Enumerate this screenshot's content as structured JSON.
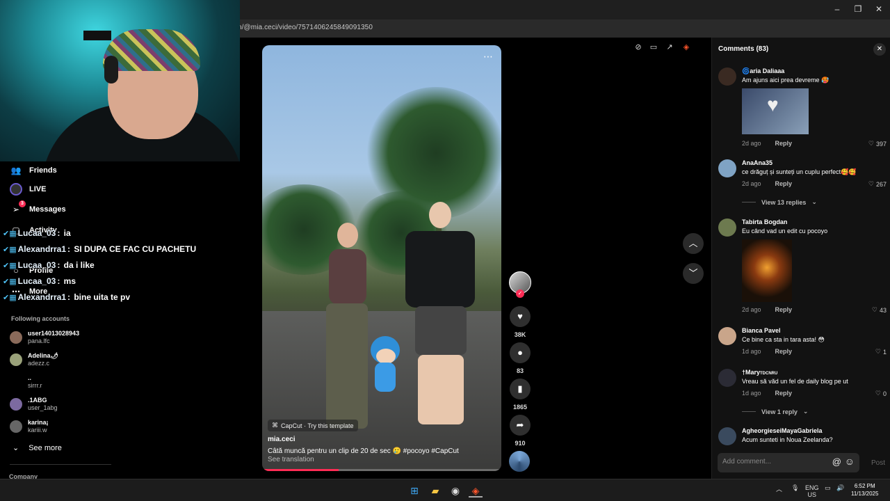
{
  "browser": {
    "url": "n/@mia.ceci/video/7571406245849091350",
    "window_controls": [
      "–",
      "❐",
      "✕"
    ]
  },
  "sidebar": {
    "nav": [
      {
        "label": "Friends",
        "icon": "friends-icon"
      },
      {
        "label": "LIVE",
        "icon": "live-icon"
      },
      {
        "label": "Messages",
        "icon": "messages-icon",
        "badge": "3"
      },
      {
        "label": "Activity",
        "icon": "activity-icon"
      },
      {
        "label": "Profile",
        "icon": "profile-icon"
      },
      {
        "label": "More",
        "icon": "more-icon"
      }
    ],
    "following_title": "Following accounts",
    "accounts": [
      {
        "name": "user14013028943",
        "handle": "pana.lfc"
      },
      {
        "name": "Adelina🌶",
        "handle": "adezz.c"
      },
      {
        "name": "..",
        "handle": "sirrr.r"
      },
      {
        "name": ".1ABG",
        "handle": "user_1abg"
      },
      {
        "name": "karina¡",
        "handle": "kariii.w"
      }
    ],
    "see_more": "See more",
    "company": "Company"
  },
  "chat": [
    {
      "user": "Lucaa_03",
      "message": "ia"
    },
    {
      "user": "Alexandrra1",
      "message": "SI DUPA CE FAC CU PACHETU"
    },
    {
      "user": "Lucaa_03",
      "message": "da i like"
    },
    {
      "user": "Lucaa_03",
      "message": "ms"
    },
    {
      "user": "Alexandrra1",
      "message": "bine uita te pv"
    }
  ],
  "video": {
    "capcut": "CapCut · Try this template",
    "author": "mia.ceci",
    "caption": "Câtă muncă pentru un clip de 20 de sec 🥲 #pocoyo #CapCut",
    "see_translation": "See translation",
    "progress": 0.32
  },
  "actions": {
    "likes": "38K",
    "comments": "83",
    "saves": "1865",
    "shares": "910"
  },
  "comments_panel": {
    "title": "Comments (83)",
    "items": [
      {
        "name": "🌀aria Daliaaa",
        "text": "Am ajuns aici prea devreme 🥵",
        "time": "2d ago",
        "reply": "Reply",
        "likes": "397"
      },
      {
        "name": "AnaAna35",
        "text": "ce drăguț și sunteți un cuplu perfect🥰🥰",
        "time": "2d ago",
        "reply": "Reply",
        "likes": "267",
        "replies": "View 13 replies"
      },
      {
        "name": "Tabirta Bogdan",
        "text": "Eu când vad un edit cu pocoyo",
        "time": "2d ago",
        "reply": "Reply",
        "likes": "43"
      },
      {
        "name": "Bianca Pavel",
        "text": "Ce bine ca sta in tara asta! 😳",
        "time": "1d ago",
        "reply": "Reply",
        "likes": "1"
      },
      {
        "name": "†Mary",
        "name_suffix": "TDCNRU",
        "text": "Vreau să văd un fel de daily blog pe ut",
        "time": "1d ago",
        "reply": "Reply",
        "likes": "0",
        "replies": "View 1 reply"
      },
      {
        "name": "AgheorgieseiMayaGabriela",
        "text": "Acum sunteti in Noua Zeelanda?"
      }
    ],
    "add_placeholder": "Add comment...",
    "post": "Post"
  },
  "taskbar": {
    "lang": "ENG",
    "region": "US",
    "time": "6:52 PM",
    "date": "11/13/2025"
  }
}
